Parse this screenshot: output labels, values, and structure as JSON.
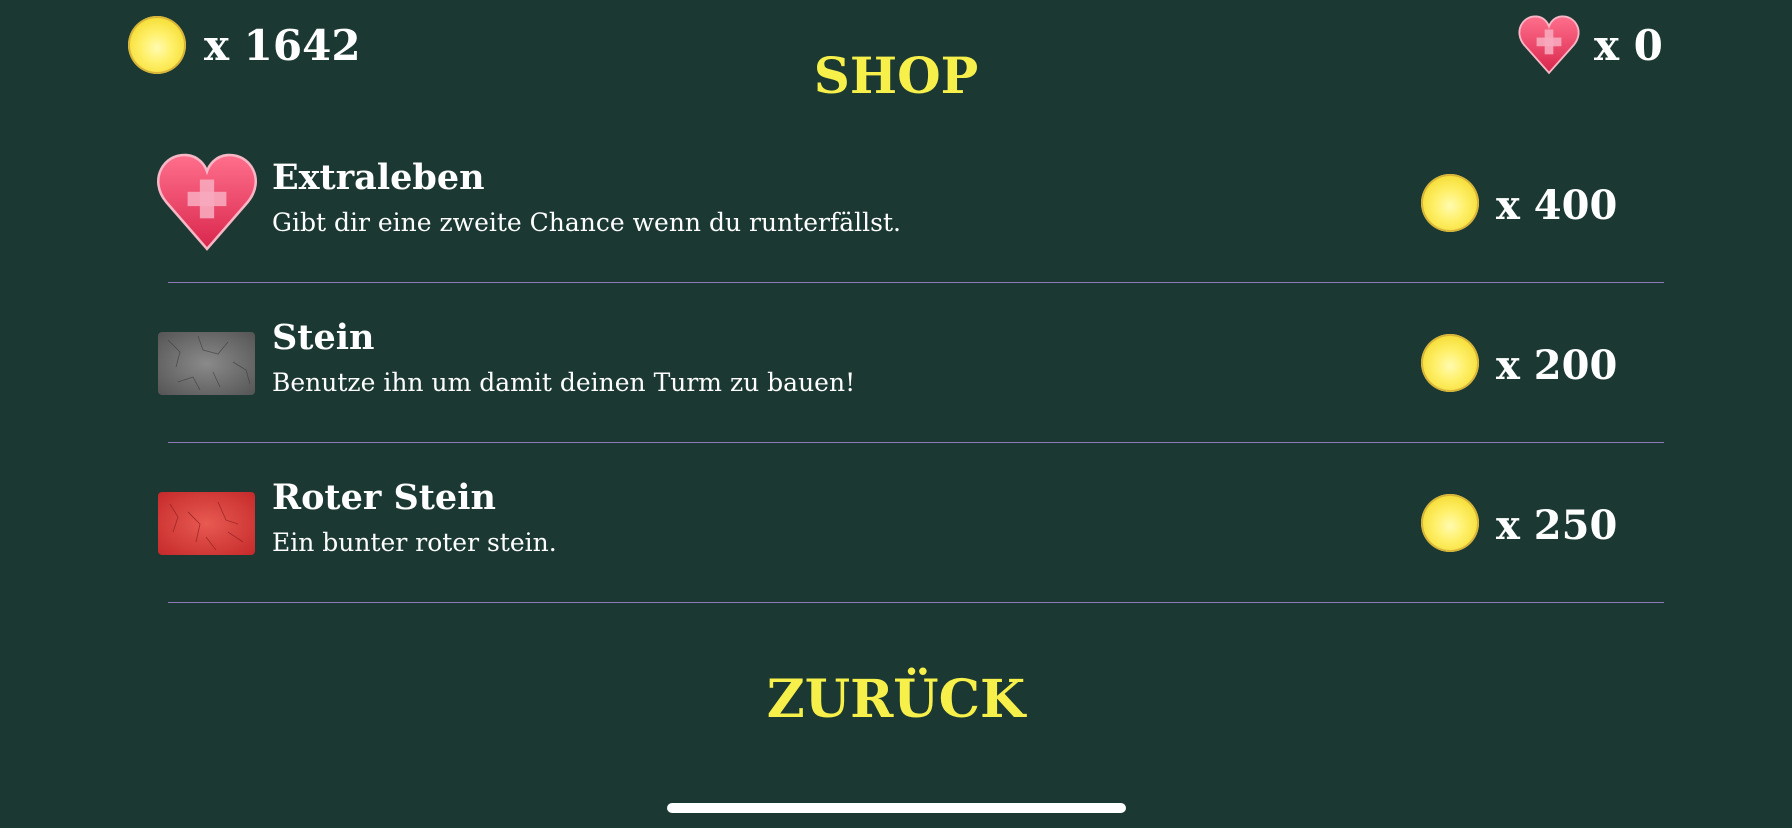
{
  "hud": {
    "coins_label": "x 1642",
    "lives_label": "x 0"
  },
  "title": "SHOP",
  "items": [
    {
      "name": "Extraleben",
      "description": "Gibt dir eine zweite Chance wenn du runterfällst.",
      "price_label": "x 400",
      "icon": "heart-plus-icon"
    },
    {
      "name": "Stein",
      "description": "Benutze ihn um damit deinen Turm zu bauen!",
      "price_label": "x 200",
      "icon": "grey-stone-icon"
    },
    {
      "name": "Roter Stein",
      "description": "Ein bunter roter stein.",
      "price_label": "x 250",
      "icon": "red-stone-icon"
    }
  ],
  "back_label": "ZURÜCK",
  "colors": {
    "background": "#1b3932",
    "title": "#f8f04a",
    "text": "#ffffff",
    "divider": "#8a78b8",
    "coin": "#f6df3a",
    "heart": "#e8365a"
  }
}
